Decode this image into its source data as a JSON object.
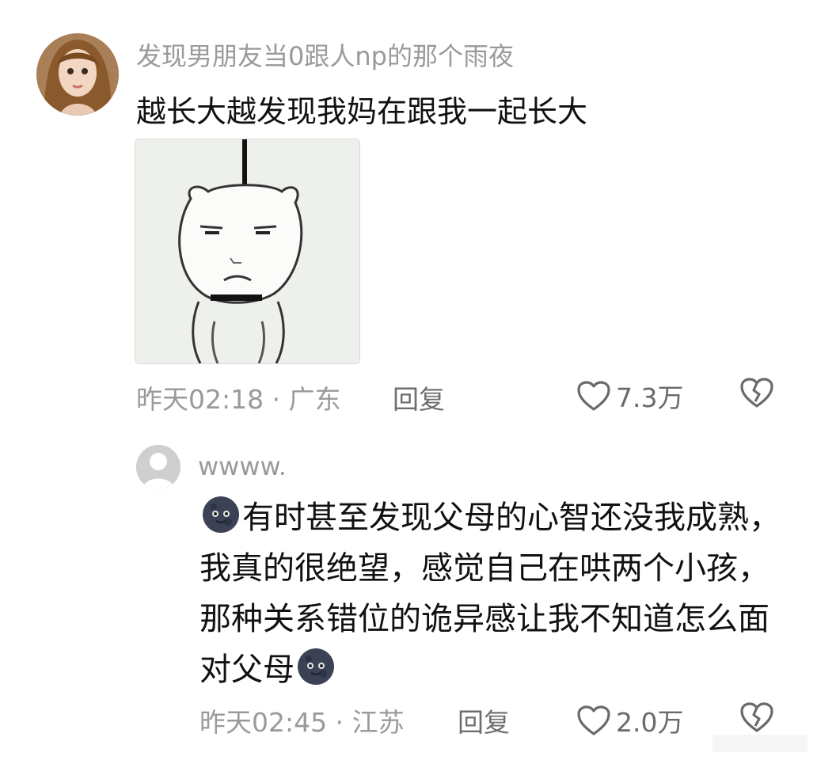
{
  "main_comment": {
    "username": "发现男朋友当0跟人np的那个雨夜",
    "text": "越长大越发现我妈在跟我一起长大",
    "time_location": "昨天02:18 · 广东",
    "reply_label": "回复",
    "likes": "7.3万"
  },
  "reply_comment": {
    "username": "wwww.",
    "text_part1": "有时甚至发现父母的心智还没我成熟，我真的很绝望，感觉自己在哄两个小孩，那种关系错位的诡异感让我不知道怎么面对父母",
    "time_location": "昨天02:45 · 江苏",
    "reply_label": "回复",
    "likes": "2.0万"
  },
  "icons": {
    "like": "heart-outline-icon",
    "dislike": "broken-heart-icon",
    "emoji": "moon-face-emoji"
  },
  "colors": {
    "text": "#111111",
    "muted": "#9a9a9a",
    "icon": "#6a6a6a"
  }
}
